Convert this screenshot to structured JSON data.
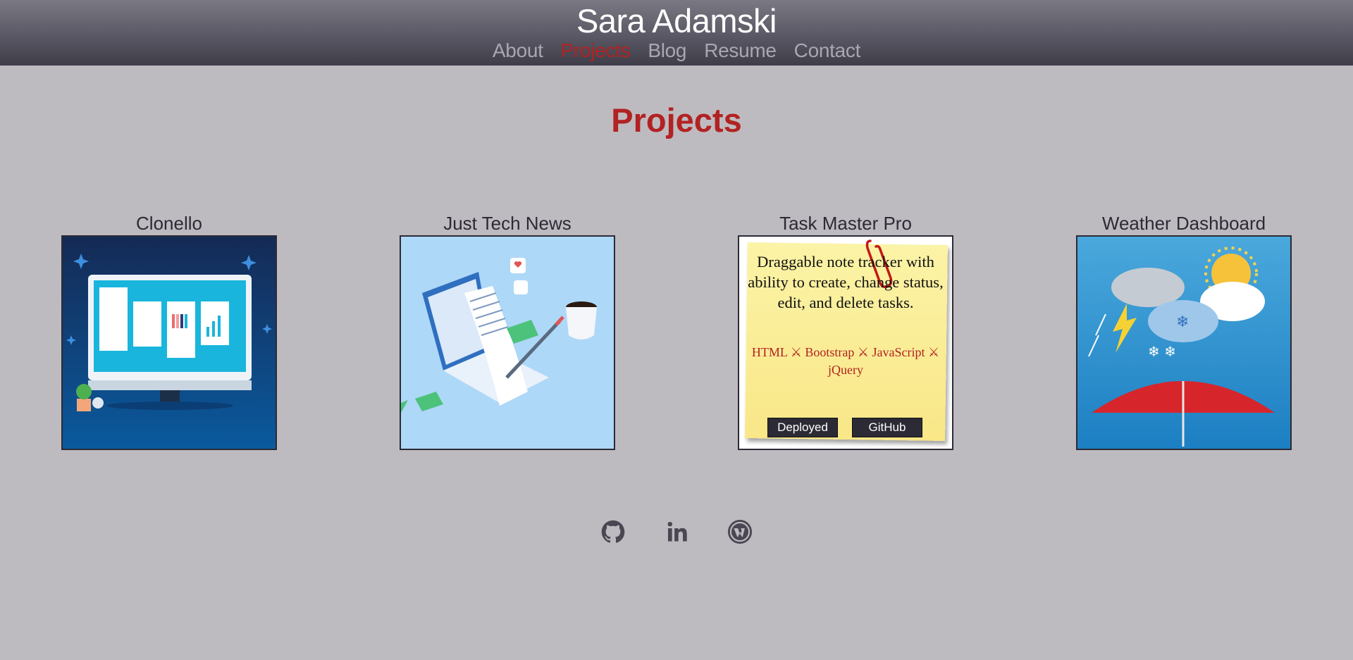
{
  "header": {
    "site_title": "Sara Adamski",
    "nav": [
      {
        "label": "About",
        "active": false
      },
      {
        "label": "Projects",
        "active": true
      },
      {
        "label": "Blog",
        "active": false
      },
      {
        "label": "Resume",
        "active": false
      },
      {
        "label": "Contact",
        "active": false
      }
    ]
  },
  "main": {
    "page_title": "Projects",
    "projects": [
      {
        "title": "Clonello",
        "icon": "kanban-board-illustration"
      },
      {
        "title": "Just Tech News",
        "icon": "laptop-news-illustration"
      },
      {
        "title": "Task Master Pro",
        "description": "Draggable note tracker with ability to create, change status, edit, and delete tasks.",
        "tech": "HTML ⚔ Bootstrap ⚔ JavaScript ⚔ jQuery",
        "buttons": {
          "deployed": "Deployed",
          "github": "GitHub"
        }
      },
      {
        "title": "Weather Dashboard",
        "icon": "weather-illustration"
      }
    ]
  },
  "footer": {
    "icons": [
      "github-icon",
      "linkedin-icon",
      "wordpress-icon"
    ]
  },
  "colors": {
    "accent": "#b22222",
    "background": "#bebbc0",
    "header_dark": "#3f3d48",
    "text": "#2c2a35"
  }
}
